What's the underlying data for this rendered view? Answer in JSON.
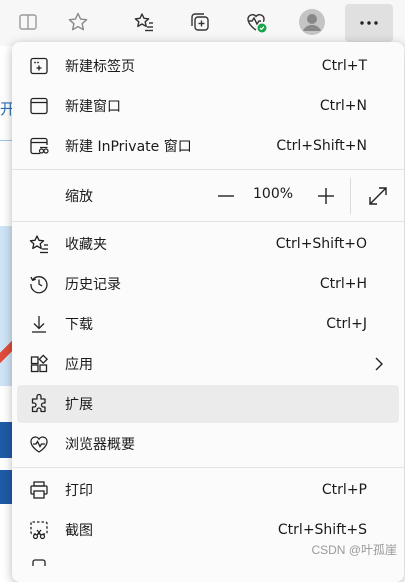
{
  "toolbar": {
    "buttons": [
      "split-screen-icon",
      "favorite-star-icon",
      "favorites-list-icon",
      "collections-icon",
      "browser-health-icon",
      "profile-avatar-icon",
      "more-options-icon"
    ]
  },
  "page_bg": {
    "text": "开"
  },
  "menu": {
    "items": [
      {
        "label": "新建标签页",
        "shortcut": "Ctrl+T",
        "icon": "new-tab-icon"
      },
      {
        "label": "新建窗口",
        "shortcut": "Ctrl+N",
        "icon": "new-window-icon"
      },
      {
        "label": "新建 InPrivate 窗口",
        "shortcut": "Ctrl+Shift+N",
        "icon": "inprivate-window-icon"
      },
      {
        "label": "收藏夹",
        "shortcut": "Ctrl+Shift+O",
        "icon": "favorites-icon"
      },
      {
        "label": "历史记录",
        "shortcut": "Ctrl+H",
        "icon": "history-icon"
      },
      {
        "label": "下载",
        "shortcut": "Ctrl+J",
        "icon": "download-icon"
      },
      {
        "label": "应用",
        "shortcut": "",
        "icon": "apps-icon"
      },
      {
        "label": "扩展",
        "shortcut": "",
        "icon": "extensions-icon"
      },
      {
        "label": "浏览器概要",
        "shortcut": "",
        "icon": "browser-essentials-icon"
      },
      {
        "label": "打印",
        "shortcut": "Ctrl+P",
        "icon": "print-icon"
      },
      {
        "label": "截图",
        "shortcut": "Ctrl+Shift+S",
        "icon": "screenshot-icon"
      }
    ],
    "zoom": {
      "label": "缩放",
      "value": "100%",
      "minus": "—",
      "plus": "+"
    }
  },
  "watermark": "CSDN @叶孤崖",
  "colors": {
    "hover": "#ebebeb",
    "health_badge": "#16a34a",
    "page_link": "#2b6fb5"
  }
}
